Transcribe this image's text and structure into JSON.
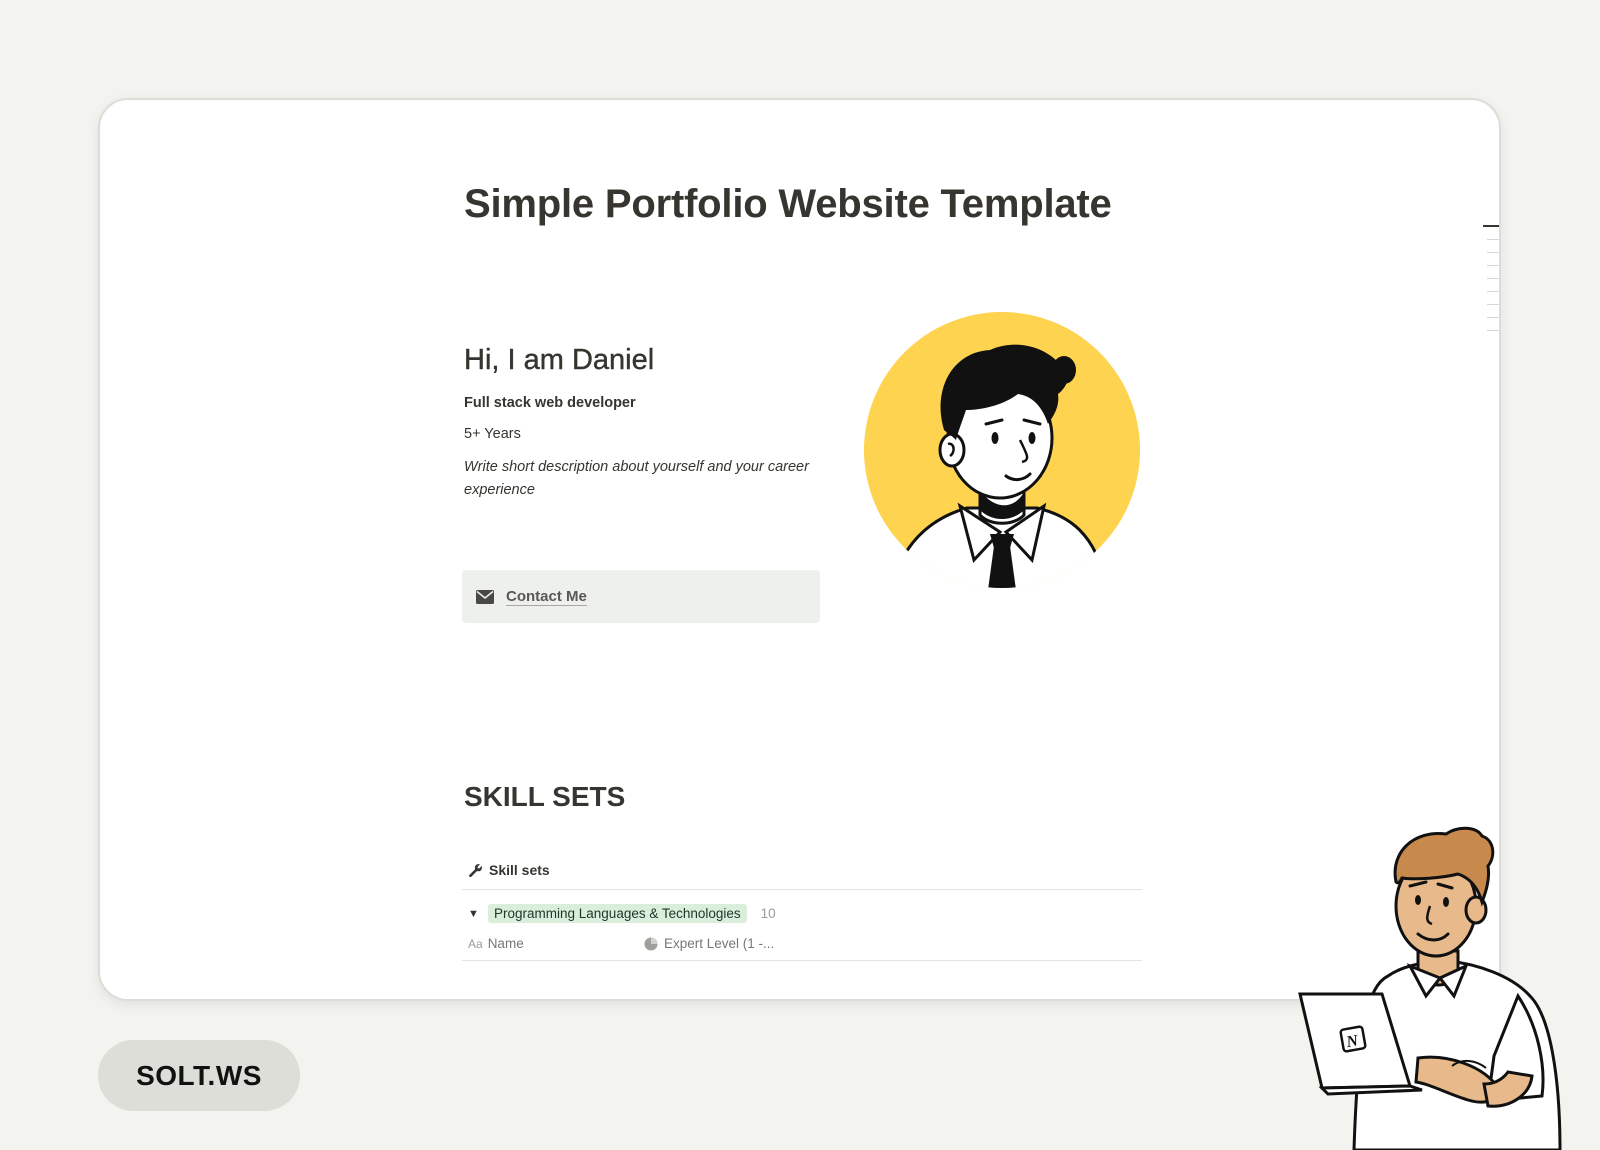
{
  "page": {
    "title": "Simple Portfolio Website Template"
  },
  "profile": {
    "greeting": "Hi, I am Daniel",
    "job_title": "Full stack web developer",
    "experience": "5+ Years",
    "description": "Write short description about yourself and your career experience",
    "contact_label": "Contact Me",
    "avatar_bg_color": "#fed350"
  },
  "skills": {
    "heading": "SKILL SETS",
    "database_title": "Skill sets",
    "group": {
      "label": "Programming Languages & Technologies",
      "count": "10",
      "tag_color": "#dbeddb"
    },
    "properties": {
      "name_icon": "Aa",
      "name_label": "Name",
      "level_label": "Expert Level (1 -..."
    }
  },
  "brand": {
    "label": "SOLT.WS"
  },
  "icons": {
    "contact": "envelope-icon",
    "database": "wrench-icon",
    "toggle": "triangle-down-icon",
    "level": "pie-chart-icon",
    "mascot_laptop": "notion-logo"
  }
}
